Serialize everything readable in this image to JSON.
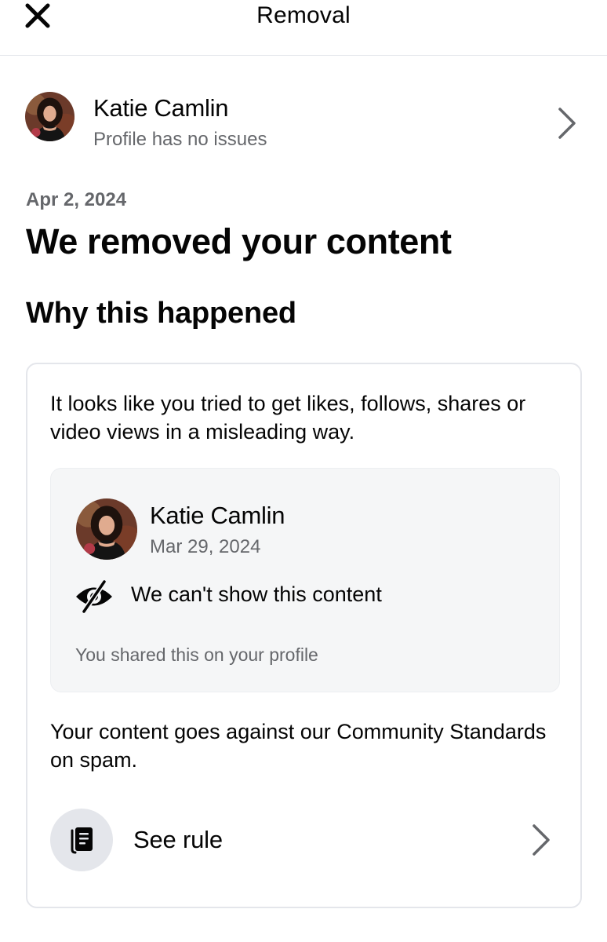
{
  "header": {
    "title": "Removal",
    "close_icon": "close-icon"
  },
  "profile": {
    "name": "Katie Camlin",
    "status": "Profile has no issues",
    "avatar_icon": "avatar"
  },
  "notice": {
    "date": "Apr 2, 2024",
    "heading": "We removed your content",
    "section_heading": "Why this happened"
  },
  "card": {
    "description": "It looks like you tried to get likes, follows, shares or video views in a misleading way.",
    "post": {
      "author": "Katie Camlin",
      "date": "Mar 29, 2024",
      "hidden_label": "We can't show this content",
      "hidden_icon": "eye-slash-icon",
      "shared_note": "You shared this on your profile"
    },
    "violation": "Your content goes against our Community Standards on spam.",
    "rule": {
      "label": "See rule",
      "icon": "rulebook-icon"
    }
  },
  "colors": {
    "text_primary": "#050505",
    "text_secondary": "#65676b",
    "divider": "#e4e6eb",
    "preview_bg": "#f5f6f7",
    "icon_circle_bg": "#e4e6eb"
  }
}
